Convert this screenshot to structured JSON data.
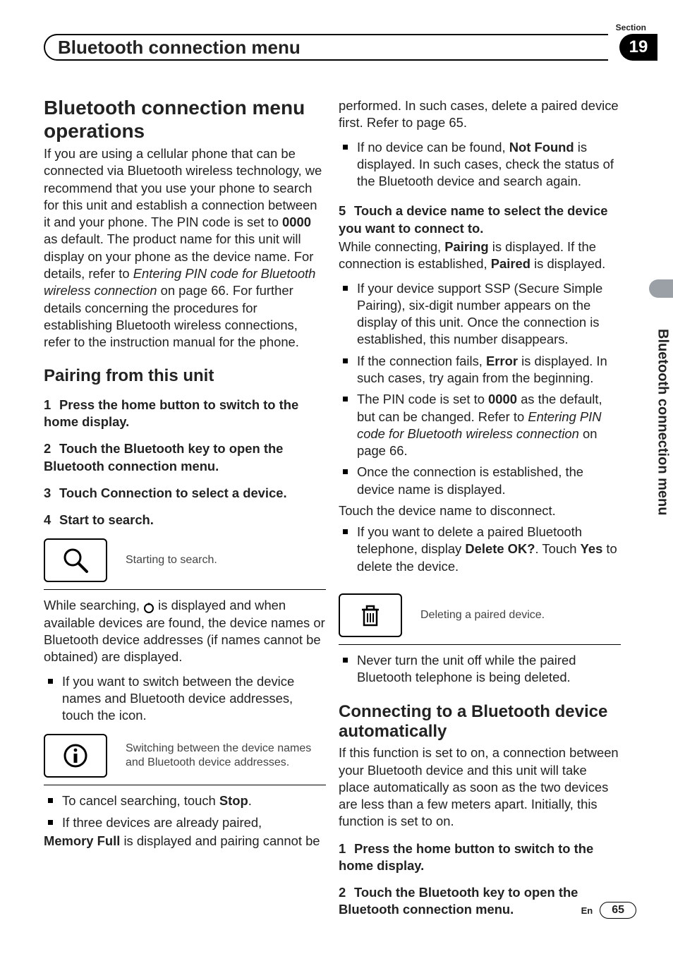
{
  "header": {
    "section_label": "Section",
    "section_number": "19",
    "title": "Bluetooth connection menu"
  },
  "side_tab": "Bluetooth connection menu",
  "footer": {
    "lang": "En",
    "page": "65"
  },
  "left": {
    "h1": "Bluetooth connection menu operations",
    "intro_a": "If you are using a cellular phone that can be connected via Bluetooth wireless technology, we recommend that you use your phone to search for this unit and establish a connection between it and your phone. The PIN code is set to ",
    "intro_bold1": "0000",
    "intro_b": " as default. The product name for this unit will display on your phone as the device name. For details, refer to ",
    "intro_ital": "Entering PIN code for Bluetooth wireless connection",
    "intro_c": " on page 66. For further details concerning the procedures for establishing Bluetooth wireless connections, refer to the instruction manual for the phone.",
    "h2_pair": "Pairing from this unit",
    "step1": "Press the home button to switch to the home display.",
    "step2": "Touch the Bluetooth key to open the Bluetooth connection menu.",
    "step3": "Touch Connection to select a device.",
    "step4": "Start to search.",
    "search_caption": "Starting to search.",
    "searching_a": "While searching, ",
    "searching_b": " is displayed and when available devices are found, the device names or Bluetooth device addresses (if names cannot be obtained) are displayed.",
    "want_switch": "If you want to switch between the device names and Bluetooth device addresses, touch the icon.",
    "info_caption": "Switching between the device names and Bluetooth device addresses.",
    "cancel_a": "To cancel searching, touch ",
    "cancel_bold": "Stop",
    "cancel_b": ".",
    "three_a": "If three devices are already paired, ",
    "three_bold": "Memory Full",
    "three_b": " is displayed and pairing cannot be"
  },
  "right": {
    "perf": "performed. In such cases, delete a paired device first. Refer to page 65.",
    "nf_a": "If no device can be found, ",
    "nf_bold": "Not Found",
    "nf_b": " is displayed. In such cases, check the status of the Bluetooth device and search again.",
    "step5": "Touch a device name to select the device you want to connect to.",
    "pair_a": "While connecting, ",
    "pair_bold1": "Pairing",
    "pair_b": " is displayed. If the connection is established, ",
    "pair_bold2": "Paired",
    "pair_c": " is displayed.",
    "ssp": "If your device support SSP (Secure Simple Pairing), six-digit number appears on the display of this unit. Once the connection is established, this number disappears.",
    "err_a": "If the connection fails, ",
    "err_bold": "Error",
    "err_b": " is displayed. In such cases, try again from the beginning.",
    "pin_a": "The PIN code is set to ",
    "pin_bold": "0000",
    "pin_b": " as the default, but can be changed. Refer to ",
    "pin_ital": "Entering PIN code for Bluetooth wireless connection",
    "pin_c": " on page 66.",
    "once": "Once the connection is established, the device name is displayed.",
    "touchname": "Touch the device name to disconnect.",
    "del_a": "If you want to delete a paired Bluetooth telephone, display ",
    "del_bold1": "Delete OK?",
    "del_b": ". Touch ",
    "del_bold2": "Yes",
    "del_c": " to delete the device.",
    "trash_caption": "Deleting a paired device.",
    "never": "Never turn the unit off while the paired Bluetooth telephone is being deleted.",
    "h2_auto": "Connecting to a Bluetooth device automatically",
    "auto_p": "If this function is set to on, a connection between your Bluetooth device and this unit will take place automatically as soon as the two devices are less than a few meters apart. Initially, this function is set to on.",
    "auto_step1": "Press the home button to switch to the home display.",
    "auto_step2": "Touch the Bluetooth key to open the Bluetooth connection menu."
  }
}
